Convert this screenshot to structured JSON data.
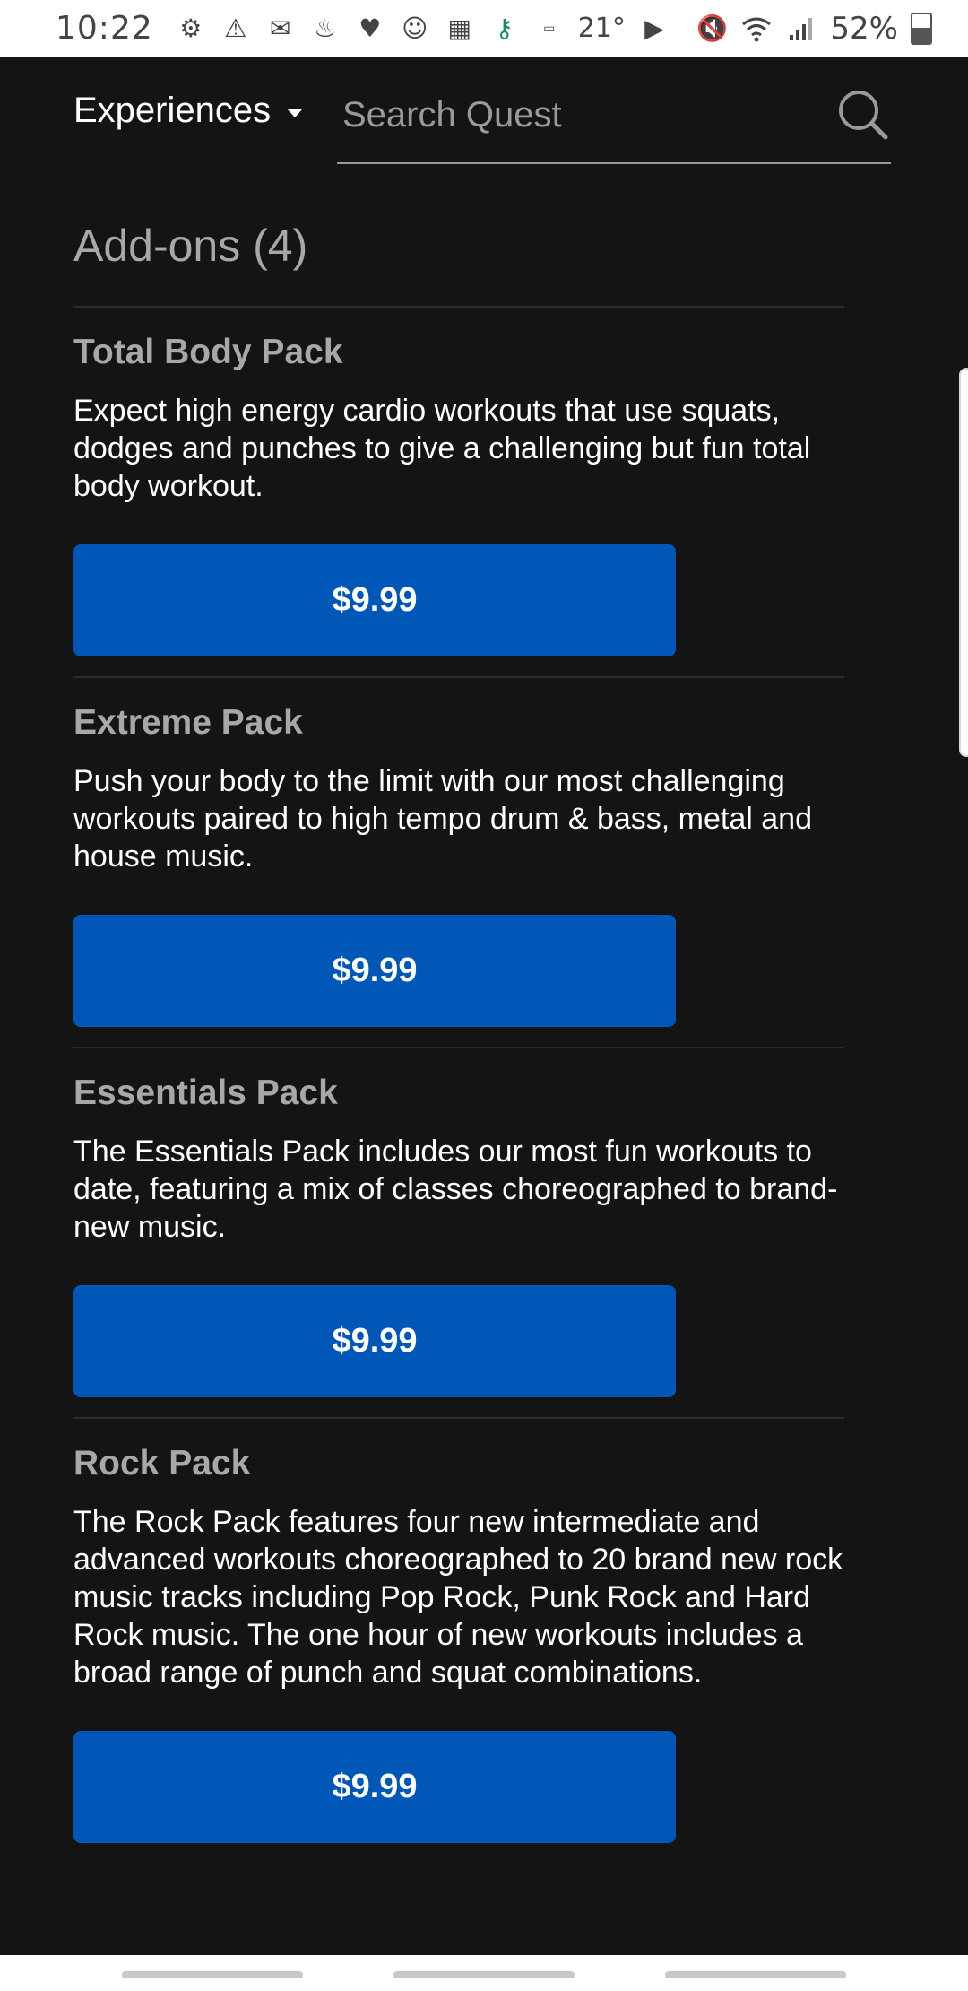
{
  "status_bar": {
    "time": "10:22",
    "temperature": "21°",
    "battery_percent": "52%",
    "battery_level": 0.52,
    "left_icons": [
      "settings-icon",
      "warning-icon",
      "gmail-icon",
      "notification-icon",
      "heart-icon",
      "baby-icon",
      "shop-icon",
      "key-icon",
      "amazon-icon",
      "play-icon"
    ],
    "right_icons": [
      "mute-icon",
      "wifi-icon",
      "signal-icon",
      "battery-icon"
    ]
  },
  "header": {
    "experiences_label": "Experiences",
    "search_placeholder": "Search Quest",
    "search_value": ""
  },
  "section": {
    "title": "Add-ons (4)"
  },
  "addons": [
    {
      "title": "Total Body Pack",
      "description": "Expect high energy cardio workouts that use squats, dodges and punches to give a challenging but fun total body workout.",
      "price": "$9.99"
    },
    {
      "title": "Extreme Pack",
      "description": "Push your body to the limit with our most challenging workouts paired to high tempo drum & bass, metal and house music.",
      "price": "$9.99"
    },
    {
      "title": "Essentials Pack",
      "description": "The Essentials Pack includes our most fun workouts to date, featuring a mix of classes choreographed to brand-new music.",
      "price": "$9.99"
    },
    {
      "title": "Rock Pack",
      "description": "The Rock Pack features four new intermediate and advanced workouts choreographed to 20 brand new rock music tracks including Pop Rock, Punk Rock and Hard Rock music. The one hour of new workouts includes a broad range of punch and squat combinations.",
      "price": "$9.99"
    }
  ],
  "colors": {
    "background": "#141414",
    "button": "#0057b8",
    "title_gray": "#a8a8a8"
  }
}
